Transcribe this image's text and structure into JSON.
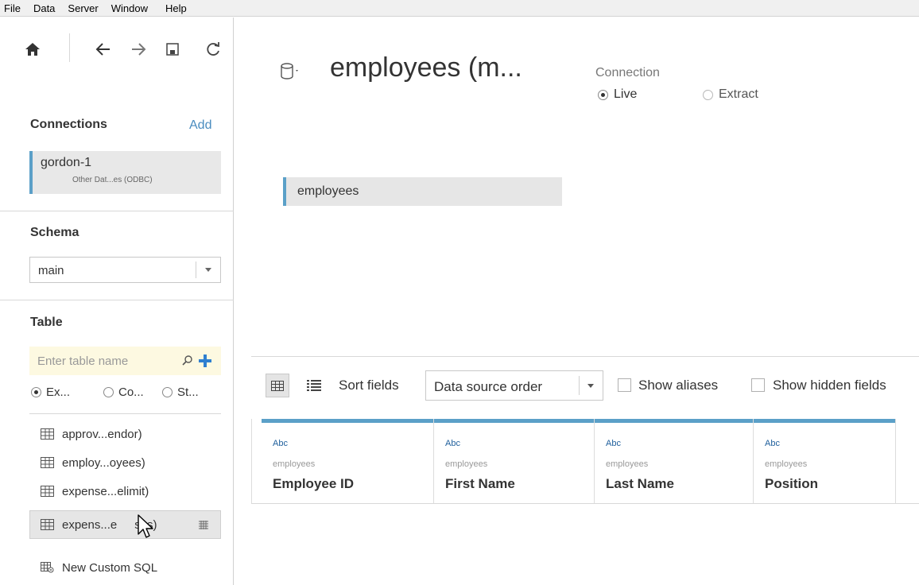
{
  "menu": [
    "File",
    "Data",
    "Server",
    "Window",
    "Help"
  ],
  "sidebar": {
    "connections_title": "Connections",
    "add_label": "Add",
    "connection": {
      "name": "gordon-1",
      "subtitle": "Other Dat...es (ODBC)"
    },
    "schema_title": "Schema",
    "schema_value": "main",
    "table_title": "Table",
    "search_placeholder": "Enter table name",
    "radio_options": [
      {
        "label": "Ex...",
        "checked": true
      },
      {
        "label": "Co...",
        "checked": false
      },
      {
        "label": "St...",
        "checked": false
      }
    ],
    "tables": [
      {
        "label": "approv...endor)"
      },
      {
        "label": "employ...oyees)"
      },
      {
        "label": "expense...elimit)"
      },
      {
        "label": "expens...e"
      },
      {
        "label": "ses)"
      }
    ],
    "custom_sql_label": "New Custom SQL"
  },
  "main": {
    "datasource_title": "employees (m...",
    "connection_label": "Connection",
    "live_label": "Live",
    "extract_label": "Extract",
    "connection_mode": "Live",
    "table_chip": "employees",
    "toolbar": {
      "sort_label": "Sort fields",
      "sort_value": "Data source order",
      "show_aliases": "Show aliases",
      "show_hidden": "Show hidden fields"
    },
    "columns": [
      {
        "type": "Abc",
        "source": "employees",
        "name": "Employee ID"
      },
      {
        "type": "Abc",
        "source": "employees",
        "name": "First Name"
      },
      {
        "type": "Abc",
        "source": "employees",
        "name": "Last Name"
      },
      {
        "type": "Abc",
        "source": "employees",
        "name": "Position"
      }
    ]
  },
  "colors": {
    "accent": "#5ba0c8",
    "link": "#4a8cbf",
    "add_plus": "#2f7fd0",
    "search_bg": "#fdf9e1"
  },
  "icons": [
    "home-icon",
    "back-icon",
    "forward-icon",
    "save-icon",
    "refresh-icon",
    "database-icon",
    "search-icon",
    "plus-icon",
    "table-icon",
    "custom-sql-icon",
    "grid-view-icon",
    "list-view-icon",
    "mouse-cursor-icon"
  ]
}
